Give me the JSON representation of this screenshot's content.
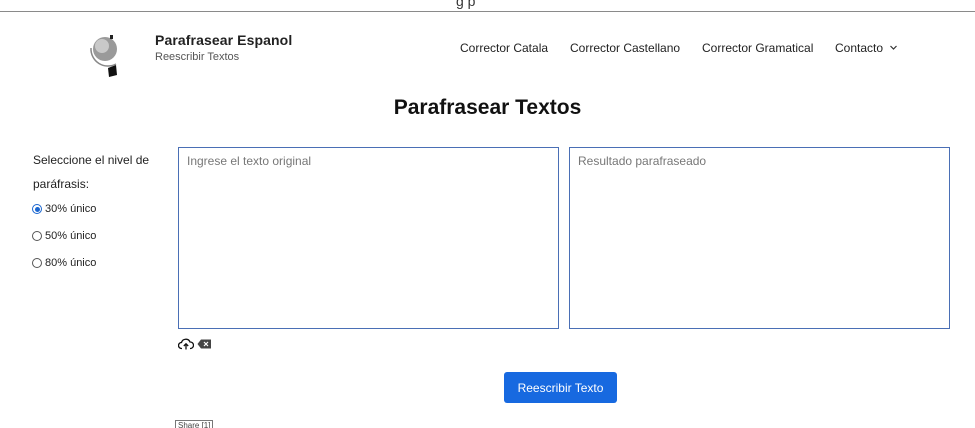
{
  "header": {
    "brand_title": "Parafrasear Espanol",
    "brand_subtitle": "Reescribir Textos",
    "top_fragment": "g  p"
  },
  "nav": {
    "items": [
      {
        "label": "Corrector Catala"
      },
      {
        "label": "Corrector Castellano"
      },
      {
        "label": "Corrector Gramatical"
      },
      {
        "label": "Contacto",
        "has_dropdown": true
      }
    ]
  },
  "main": {
    "title": "Parafrasear Textos",
    "level_label": "Seleccione el nivel de paráfrasis:",
    "options": [
      {
        "label": "30% único",
        "checked": true
      },
      {
        "label": "50% único",
        "checked": false
      },
      {
        "label": "80% único",
        "checked": false
      }
    ],
    "input_placeholder": "Ingrese el texto original",
    "output_placeholder": "Resultado parafraseado",
    "submit_label": "Reescribir Texto",
    "share_label": "Share [1]"
  },
  "colors": {
    "accent": "#1769e0",
    "box_border": "#4a6fb5"
  },
  "icons": [
    "logo-icon",
    "chevron-down-icon",
    "upload-cloud-icon",
    "clear-icon"
  ]
}
